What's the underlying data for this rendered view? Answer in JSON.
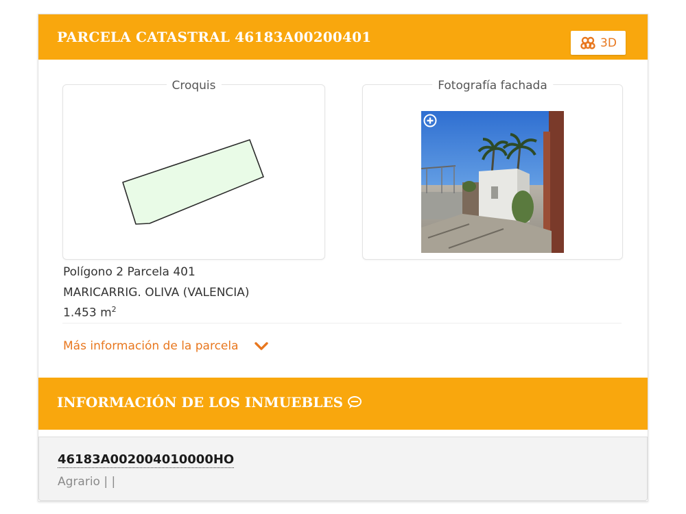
{
  "parcela": {
    "title": "PARCELA CATASTRAL 46183A00200401",
    "btn_3d_label": "3D",
    "croquis_label": "Croquis",
    "foto_label": "Fotografía fachada",
    "location_line": "Polígono 2 Parcela 401",
    "municipality_line": "MARICARRIG. OLIVA (VALENCIA)",
    "area_value": "1.453 m",
    "area_unit_exp": "2",
    "more_info_label": "Más información de la parcela"
  },
  "inmuebles": {
    "title": "INFORMACIÓN DE LOS INMUEBLES",
    "items": [
      {
        "reference": "46183A002004010000HO",
        "type": "Agrario | |"
      }
    ]
  },
  "colors": {
    "accent": "#f9a70d",
    "link": "#e8771e",
    "parcel_fill": "#e9fbe7",
    "parcel_stroke": "#2a2a2a"
  },
  "icons": [
    "users-3d-icon",
    "zoom-plus-icon",
    "chevron-down-icon",
    "comment-icon"
  ]
}
